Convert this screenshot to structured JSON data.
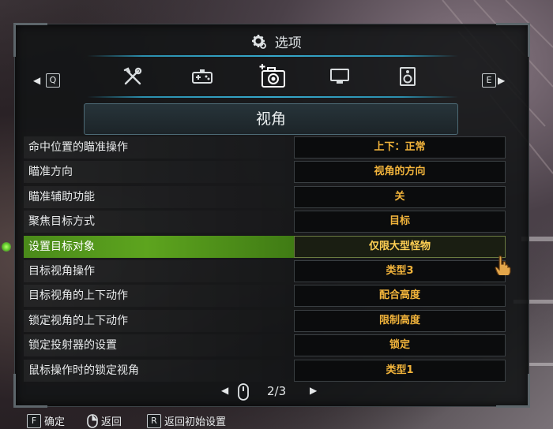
{
  "window": {
    "title": "选项"
  },
  "tabs": {
    "left_key": "Q",
    "right_key": "E",
    "items": [
      {
        "icon": "tools-icon"
      },
      {
        "icon": "gamepad-icon"
      },
      {
        "icon": "camera-icon",
        "active": true
      },
      {
        "icon": "monitor-icon"
      },
      {
        "icon": "speaker-icon"
      }
    ]
  },
  "section": {
    "title": "视角"
  },
  "settings": [
    {
      "label": "命中位置的瞄准操作",
      "value": "上下：正常"
    },
    {
      "label": "瞄准方向",
      "value": "视角的方向"
    },
    {
      "label": "瞄准辅助功能",
      "value": "关"
    },
    {
      "label": "聚焦目标方式",
      "value": "目标"
    },
    {
      "label": "设置目标对象",
      "value": "仅限大型怪物",
      "selected": true
    },
    {
      "label": "目标视角操作",
      "value": "类型3"
    },
    {
      "label": "目标视角的上下动作",
      "value": "配合高度"
    },
    {
      "label": "锁定视角的上下动作",
      "value": "限制高度"
    },
    {
      "label": "锁定投射器的设置",
      "value": "锁定"
    },
    {
      "label": "鼠标操作时的锁定视角",
      "value": "类型1"
    }
  ],
  "pager": {
    "current": "2",
    "sep": "/",
    "total": "3"
  },
  "footer": {
    "confirm_key": "F",
    "confirm_label": "确定",
    "back_label": "返回",
    "reset_key": "R",
    "reset_label": "返回初始设置"
  },
  "colors": {
    "value_text": "#f2b43b",
    "selected_row": "#5da41e",
    "accent_line": "#36a9cc"
  }
}
